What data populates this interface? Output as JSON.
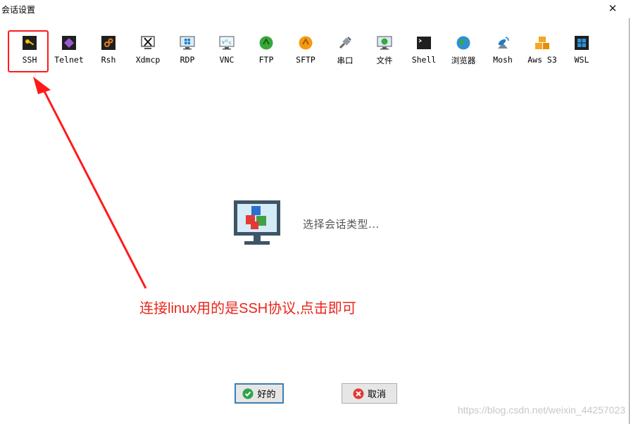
{
  "window": {
    "title": "会话设置",
    "close_glyph": "✕"
  },
  "toolbar": {
    "items": [
      {
        "label": "SSH",
        "icon": "key-icon"
      },
      {
        "label": "Telnet",
        "icon": "telnet-icon"
      },
      {
        "label": "Rsh",
        "icon": "rsh-icon"
      },
      {
        "label": "Xdmcp",
        "icon": "xdmcp-icon"
      },
      {
        "label": "RDP",
        "icon": "rdp-icon"
      },
      {
        "label": "VNC",
        "icon": "vnc-icon"
      },
      {
        "label": "FTP",
        "icon": "ftp-icon"
      },
      {
        "label": "SFTP",
        "icon": "sftp-icon"
      },
      {
        "label": "串口",
        "icon": "serial-icon"
      },
      {
        "label": "文件",
        "icon": "file-icon"
      },
      {
        "label": "Shell",
        "icon": "shell-icon"
      },
      {
        "label": "浏览器",
        "icon": "browser-icon"
      },
      {
        "label": "Mosh",
        "icon": "mosh-icon"
      },
      {
        "label": "Aws S3",
        "icon": "aws-s3-icon"
      },
      {
        "label": "WSL",
        "icon": "wsl-icon"
      }
    ]
  },
  "main": {
    "prompt": "选择会话类型..."
  },
  "annotation": {
    "text": "连接linux用的是SSH协议,点击即可"
  },
  "buttons": {
    "ok": "好的",
    "cancel": "取消"
  },
  "watermark": "https://blog.csdn.net/weixin_44257023",
  "colors": {
    "annotation": "#e8261b",
    "highlight": "#ff1a1a",
    "ok_border": "#3c7fb1"
  }
}
